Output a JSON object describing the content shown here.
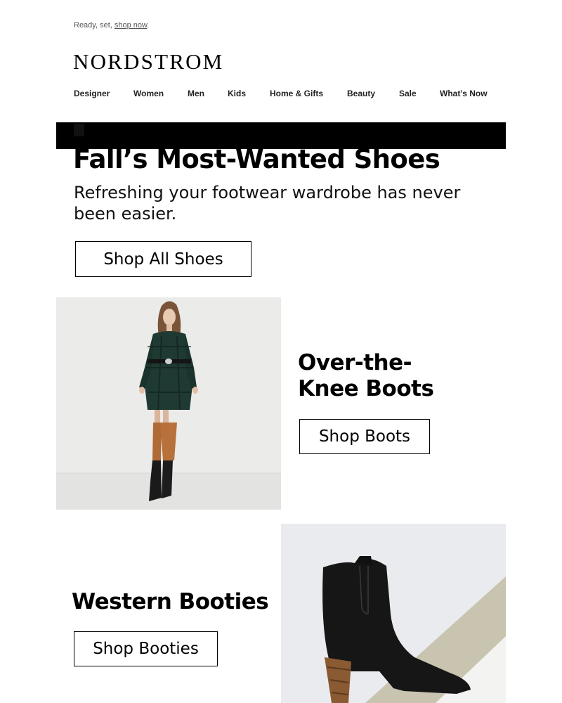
{
  "preheader": {
    "text_before": "Ready, set, ",
    "link_label": "shop now",
    "text_after": "."
  },
  "brand": {
    "name": "NORDSTROM"
  },
  "nav": {
    "items": [
      {
        "label": "Designer"
      },
      {
        "label": "Women"
      },
      {
        "label": "Men"
      },
      {
        "label": "Kids"
      },
      {
        "label": "Home & Gifts"
      },
      {
        "label": "Beauty"
      },
      {
        "label": "Sale"
      },
      {
        "label": "What’s Now"
      }
    ]
  },
  "hero": {
    "headline": "Fall’s Most-Wanted Shoes",
    "subhead": "Refreshing your footwear wardrobe has never been easier.",
    "cta_label": "Shop All Shoes"
  },
  "tiles": [
    {
      "title": "Over-the-Knee Boots",
      "title_line1": "Over-the-",
      "title_line2": "Knee Boots",
      "cta_label": "Shop Boots",
      "image": "model-in-plaid-coat-and-over-the-knee-boots"
    },
    {
      "title": "Western Booties",
      "cta_label": "Shop Booties",
      "image": "black-suede-western-bootie"
    }
  ],
  "colors": {
    "background": "#ffffff",
    "text": "#000000",
    "hero_bar": "#000000"
  }
}
